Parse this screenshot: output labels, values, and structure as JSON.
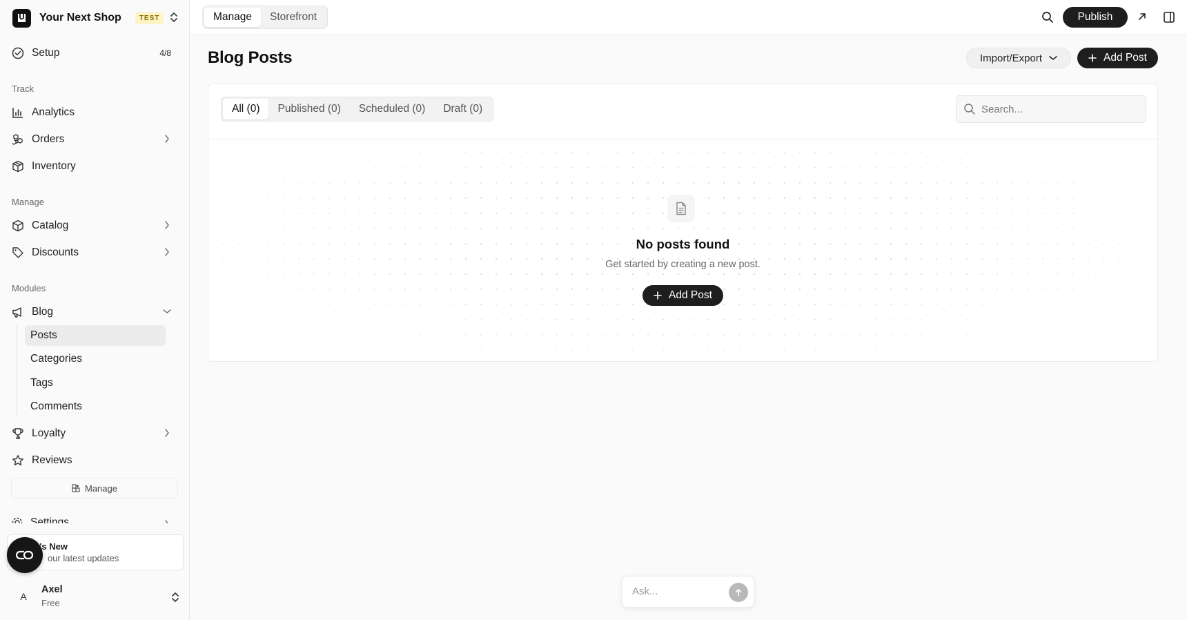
{
  "brand": {
    "name": "Your Next Shop",
    "badge": "TEST"
  },
  "sidebar": {
    "setup": {
      "label": "Setup",
      "count": "4/8"
    },
    "sections": {
      "track": "Track",
      "manage": "Manage",
      "modules": "Modules"
    },
    "track_items": [
      {
        "label": "Analytics",
        "icon": "bar-chart-icon"
      },
      {
        "label": "Orders",
        "icon": "orders-icon"
      },
      {
        "label": "Inventory",
        "icon": "box-icon"
      }
    ],
    "manage_items": [
      {
        "label": "Catalog",
        "icon": "package-icon"
      },
      {
        "label": "Discounts",
        "icon": "tag-icon"
      }
    ],
    "modules_items": {
      "blog": {
        "label": "Blog",
        "icon": "megaphone-icon"
      },
      "blog_sub": [
        "Posts",
        "Categories",
        "Tags",
        "Comments"
      ],
      "loyalty": {
        "label": "Loyalty",
        "icon": "trophy-icon"
      },
      "reviews": {
        "label": "Reviews",
        "icon": "star-icon"
      }
    },
    "manage_modules": "Manage",
    "settings": "Settings",
    "whats_new": {
      "title": "t's New",
      "subtitle": "our latest updates"
    },
    "user": {
      "initial": "A",
      "name": "Axel",
      "plan": "Free"
    }
  },
  "topbar": {
    "tabs": [
      "Manage",
      "Storefront"
    ],
    "publish": "Publish"
  },
  "main": {
    "title": "Blog Posts",
    "import_export": "Import/Export",
    "add_post": "Add Post",
    "filters": [
      "All (0)",
      "Published (0)",
      "Scheduled (0)",
      "Draft (0)"
    ],
    "search_placeholder": "Search...",
    "empty": {
      "title": "No posts found",
      "subtitle": "Get started by creating a new post.",
      "button": "Add Post"
    },
    "ask_placeholder": "Ask..."
  }
}
